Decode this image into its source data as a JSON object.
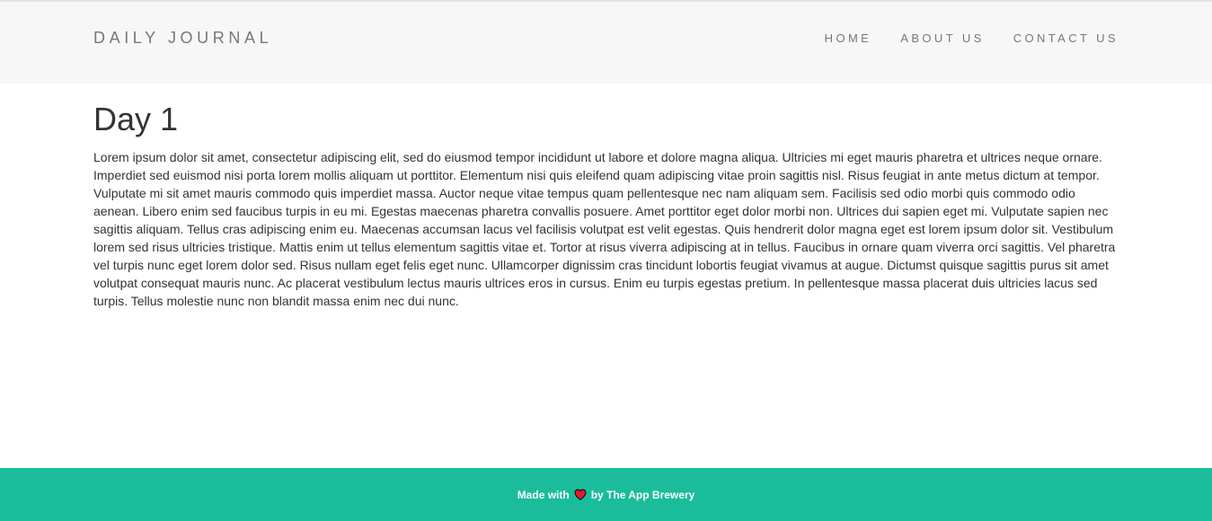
{
  "navbar": {
    "brand": "DAILY JOURNAL",
    "links": [
      {
        "label": "HOME"
      },
      {
        "label": "ABOUT US"
      },
      {
        "label": "CONTACT US"
      }
    ]
  },
  "post": {
    "title": "Day 1",
    "body": "Lorem ipsum dolor sit amet, consectetur adipiscing elit, sed do eiusmod tempor incididunt ut labore et dolore magna aliqua. Ultricies mi eget mauris pharetra et ultrices neque ornare. Imperdiet sed euismod nisi porta lorem mollis aliquam ut porttitor. Elementum nisi quis eleifend quam adipiscing vitae proin sagittis nisl. Risus feugiat in ante metus dictum at tempor. Vulputate mi sit amet mauris commodo quis imperdiet massa. Auctor neque vitae tempus quam pellentesque nec nam aliquam sem. Facilisis sed odio morbi quis commodo odio aenean. Libero enim sed faucibus turpis in eu mi. Egestas maecenas pharetra convallis posuere. Amet porttitor eget dolor morbi non. Ultrices dui sapien eget mi. Vulputate sapien nec sagittis aliquam. Tellus cras adipiscing enim eu. Maecenas accumsan lacus vel facilisis volutpat est velit egestas. Quis hendrerit dolor magna eget est lorem ipsum dolor sit. Vestibulum lorem sed risus ultricies tristique. Mattis enim ut tellus elementum sagittis vitae et. Tortor at risus viverra adipiscing at in tellus. Faucibus in ornare quam viverra orci sagittis. Vel pharetra vel turpis nunc eget lorem dolor sed. Risus nullam eget felis eget nunc. Ullamcorper dignissim cras tincidunt lobortis feugiat vivamus at augue. Dictumst quisque sagittis purus sit amet volutpat consequat mauris nunc. Ac placerat vestibulum lectus mauris ultrices eros in cursus. Enim eu turpis egestas pretium. In pellentesque massa placerat duis ultricies lacus sed turpis. Tellus molestie nunc non blandit massa enim nec dui nunc."
  },
  "footer": {
    "prefix": "Made with",
    "icon": "heart-icon",
    "suffix": "by The App Brewery"
  },
  "colors": {
    "navbar_bg": "#f7f7f7",
    "footer_bg": "#1abc9c",
    "heart": "#e0192f",
    "nav_text": "#777777",
    "body_text": "#333333"
  }
}
